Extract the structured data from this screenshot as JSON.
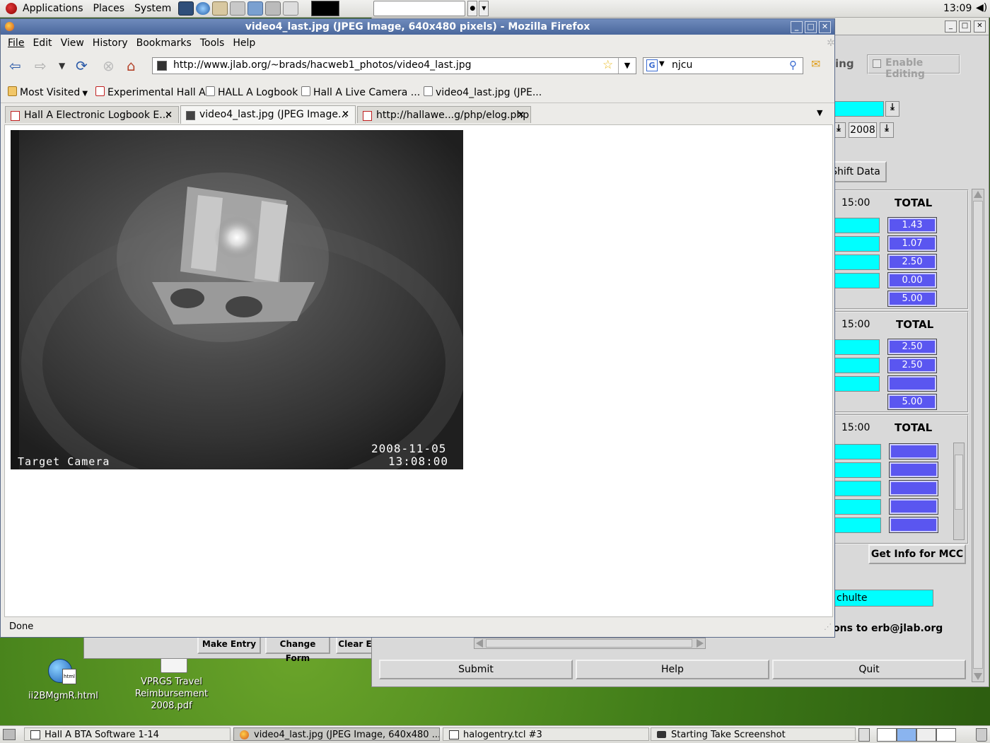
{
  "top_panel": {
    "menus": [
      "Applications",
      "Places",
      "System"
    ],
    "clock": "13:09"
  },
  "firefox": {
    "title": "video4_last.jpg (JPEG Image, 640x480 pixels) - Mozilla Firefox",
    "menu": [
      "File",
      "Edit",
      "View",
      "History",
      "Bookmarks",
      "Tools",
      "Help"
    ],
    "url": "http://www.jlab.org/~brads/hacweb1_photos/video4_last.jpg",
    "search_value": "njcu",
    "bookmarks": [
      "Most Visited",
      "Experimental Hall A",
      "HALL A Logbook",
      "Hall A Live Camera ...",
      "video4_last.jpg (JPE..."
    ],
    "tabs": [
      {
        "label": "Hall A Electronic Logbook E..."
      },
      {
        "label": "video4_last.jpg (JPEG Image..."
      },
      {
        "label": "http://hallawe...g/php/elog.php"
      }
    ],
    "status": "Done",
    "image_overlay": {
      "date": "2008-11-05",
      "time": "13:08:00",
      "caption": "Target Camera"
    }
  },
  "bg_app": {
    "enable_editing": "Enable Editing",
    "ing_fragment": "ing",
    "year": "2008",
    "shift_data": "Shift Data",
    "time_header": "15:00",
    "total_header": "TOTAL",
    "section1_values": [
      "1.43",
      "1.07",
      "2.50",
      "0.00",
      "5.00"
    ],
    "section2_values": [
      "2.50",
      "2.50",
      "",
      "5.00"
    ],
    "get_info": "Get Info for MCC",
    "name_field": "chulte",
    "contact": "ons to erb@jlab.org",
    "buttons": {
      "submit": "Submit",
      "help": "Help",
      "quit": "Quit"
    }
  },
  "old_window": {
    "buttons": [
      "Make Entry",
      "Change Form",
      "Clear E"
    ]
  },
  "desktop_icons": [
    {
      "label": "ii2BMgmR.html"
    },
    {
      "label": "VPRGS Travel Reimbursement 2008.pdf"
    }
  ],
  "taskbar": [
    {
      "label": "Hall A BTA Software 1-14"
    },
    {
      "label": "video4_last.jpg (JPEG Image, 640x480 ..."
    },
    {
      "label": "halogentry.tcl #3"
    },
    {
      "label": "Starting Take Screenshot"
    }
  ]
}
